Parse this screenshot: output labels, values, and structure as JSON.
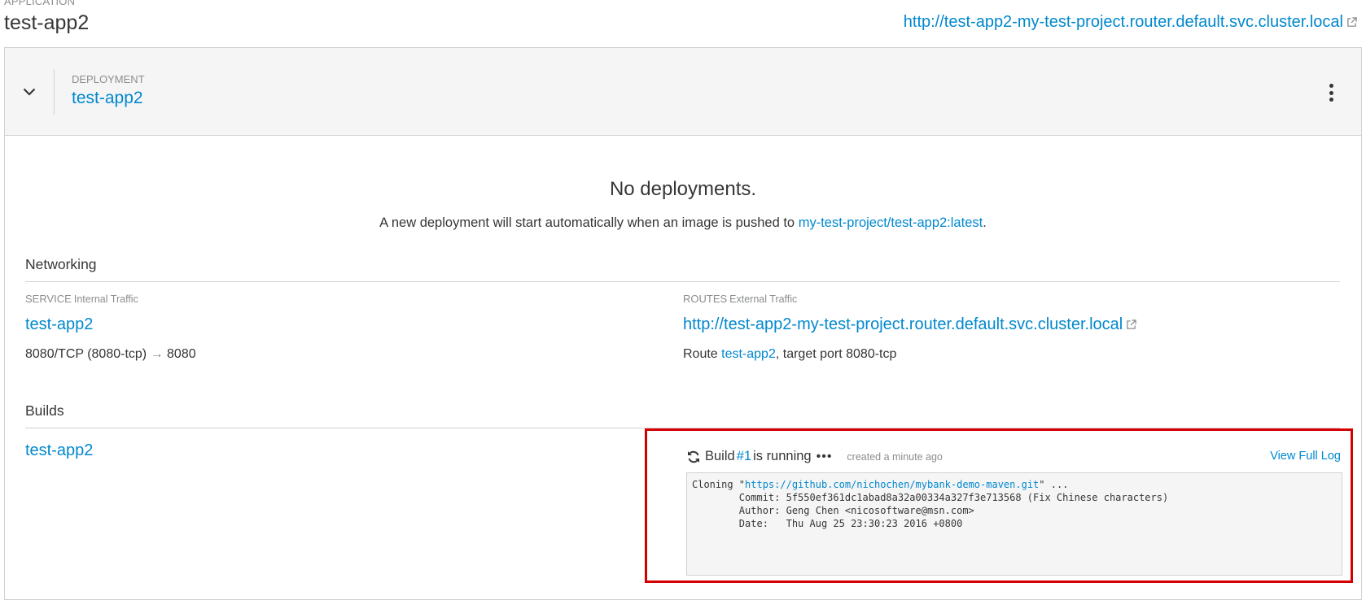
{
  "application": {
    "label": "APPLICATION",
    "name": "test-app2",
    "url": "http://test-app2-my-test-project.router.default.svc.cluster.local"
  },
  "deployment": {
    "label": "DEPLOYMENT",
    "name": "test-app2",
    "empty_title": "No deployments.",
    "empty_message_prefix": "A new deployment will start automatically when an image is pushed to ",
    "empty_message_link": "my-test-project/test-app2:latest",
    "empty_message_suffix": "."
  },
  "networking": {
    "title": "Networking",
    "service": {
      "label": "SERVICE",
      "sublabel": "Internal Traffic",
      "name": "test-app2",
      "ports_left": "8080/TCP (8080-tcp)",
      "arrow": "→",
      "ports_right": "8080"
    },
    "routes": {
      "label": "ROUTES",
      "sublabel": "External Traffic",
      "url": "http://test-app2-my-test-project.router.default.svc.cluster.local",
      "route_prefix": "Route ",
      "route_name": "test-app2",
      "route_suffix": ", target port 8080-tcp"
    }
  },
  "builds": {
    "title": "Builds",
    "config_name": "test-app2",
    "status_prefix": "Build ",
    "build_number": "#1",
    "status_suffix": " is running",
    "dots": "•••",
    "created": "created a minute ago",
    "view_full_log": "View Full Log",
    "log": {
      "line1_prefix": "Cloning \"",
      "repo_url": "https://github.com/nichochen/mybank-demo-maven.git",
      "line1_suffix": "\" ...",
      "line2": "        Commit: 5f550ef361dc1abad8a32a00334a327f3e713568 (Fix Chinese characters)",
      "line3": "        Author: Geng Chen <nicosoftware@msn.com>",
      "line4": "        Date:   Thu Aug 25 23:30:23 2016 +0800"
    }
  },
  "colors": {
    "link": "#0088ce",
    "highlight_border": "#d40000",
    "header_bg": "#f5f5f5",
    "muted_text": "#8b8d8f"
  },
  "icons": [
    "external-link-icon",
    "chevron-down-icon",
    "kebab-menu-icon",
    "sync-icon"
  ]
}
